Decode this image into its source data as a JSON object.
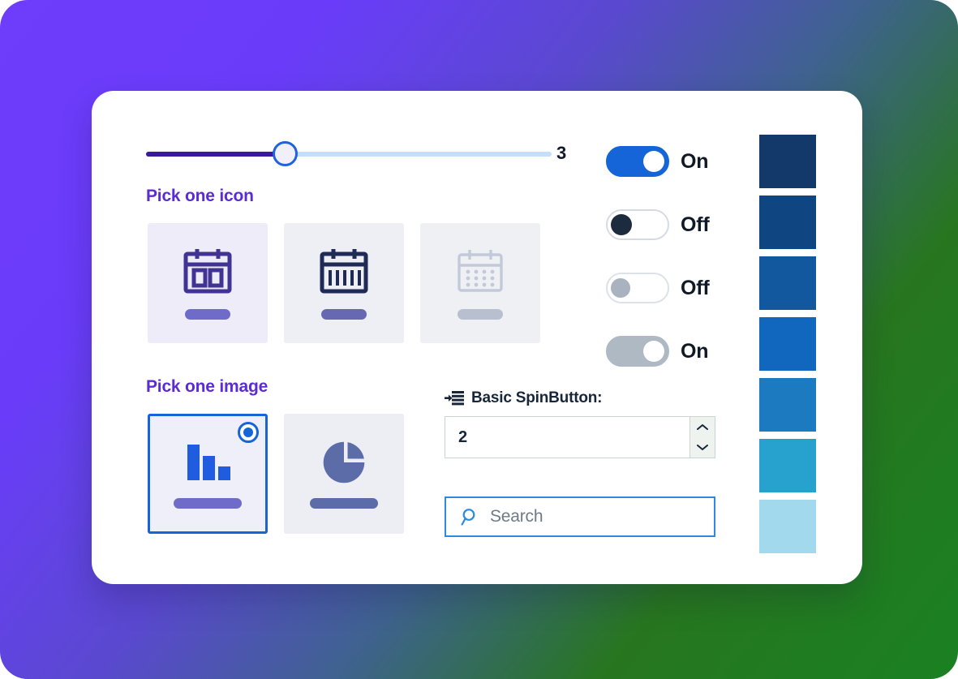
{
  "background": {
    "gradient_from": "#6e3cfb",
    "gradient_to": "#1a8122"
  },
  "slider": {
    "name": "volume-slider",
    "value": "3",
    "min": 0,
    "max": 10,
    "fill_percent": 34,
    "fill_color": "#3b199d",
    "track_color": "#c3dffc",
    "thumb_border_color": "#1f62e0"
  },
  "icon_picker": {
    "label": "Pick one icon",
    "label_color": "#5b2bd4",
    "options": [
      {
        "name": "calendar-two-block-icon",
        "icon": "calendar-two-block",
        "color": "#413393",
        "bar_color": "#6e6cc8",
        "card_bg": "#eeecf8",
        "state": "enabled"
      },
      {
        "name": "calendar-columns-icon",
        "icon": "calendar-columns",
        "color": "#1f2a56",
        "bar_color": "#6668b4",
        "card_bg": "#eeeff5",
        "state": "enabled"
      },
      {
        "name": "calendar-dots-icon",
        "icon": "calendar-dots",
        "color": "#c2cada",
        "bar_color": "#b8bfcf",
        "card_bg": "#eff0f3",
        "state": "disabled"
      }
    ]
  },
  "image_picker": {
    "label": "Pick one image",
    "label_color": "#5b2bd4",
    "options": [
      {
        "name": "bar-chart-image",
        "icon": "bar-chart",
        "color": "#1f5ce0",
        "bar_color": "#6e6cc8",
        "selected": true,
        "radio_color": "#1565d8"
      },
      {
        "name": "pie-chart-image",
        "icon": "pie-chart",
        "color": "#5b6ca8",
        "bar_color": "#5b6ca8",
        "selected": false,
        "radio_color": "#1565d8"
      }
    ]
  },
  "toggles": [
    {
      "name": "toggle-on-enabled",
      "label": "On",
      "state": "on",
      "variant": "on-blue",
      "color": "#1565d8"
    },
    {
      "name": "toggle-off-enabled",
      "label": "Off",
      "state": "off",
      "variant": "off-dark",
      "color": "#1c2b3e"
    },
    {
      "name": "toggle-off-disabled",
      "label": "Off",
      "state": "off",
      "variant": "off-muted",
      "color": "#a9b2bf"
    },
    {
      "name": "toggle-on-disabled",
      "label": "On",
      "state": "on",
      "variant": "on-muted",
      "color": "#aeb9c4"
    }
  ],
  "spinbutton": {
    "icon": "increase-indent-icon",
    "label": "Basic SpinButton:",
    "value": "2",
    "increment_label": "▲",
    "decrement_label": "▼"
  },
  "search": {
    "icon": "search-icon",
    "placeholder": "Search",
    "value": "",
    "border_color": "#2c8ae0"
  },
  "swatches": [
    {
      "name": "swatch-blue-900",
      "color": "#13396b"
    },
    {
      "name": "swatch-blue-800",
      "color": "#0f4681"
    },
    {
      "name": "swatch-blue-700",
      "color": "#11589f"
    },
    {
      "name": "swatch-blue-600",
      "color": "#1166bd"
    },
    {
      "name": "swatch-blue-500",
      "color": "#1b7ac0"
    },
    {
      "name": "swatch-blue-400",
      "color": "#27a2cf"
    },
    {
      "name": "swatch-blue-200",
      "color": "#a3d9ec"
    }
  ]
}
